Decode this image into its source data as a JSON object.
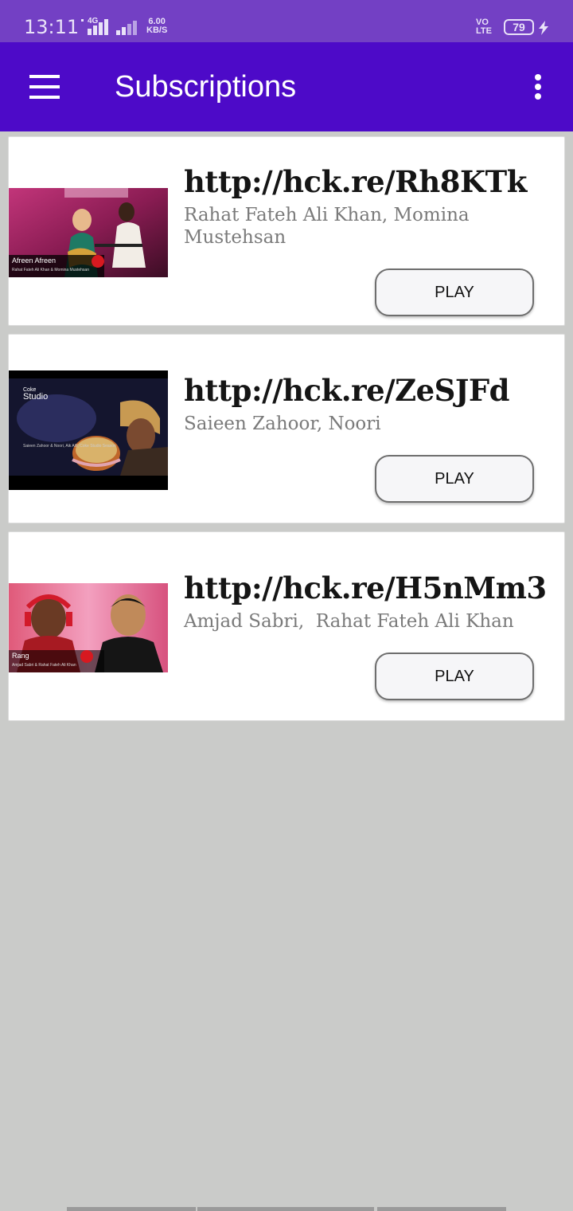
{
  "status_bar": {
    "time": "13:11",
    "network": "4G",
    "speed_value": "6.00",
    "speed_unit": "KB/S",
    "volte_top": "VO",
    "volte_bottom": "LTE",
    "battery": "79",
    "bg_color": "#7340c4"
  },
  "app_bar": {
    "title": "Subscriptions",
    "menu_icon": "hamburger-menu-icon",
    "more_icon": "more-vert-icon",
    "bg_color": "#4d0ac8"
  },
  "subscriptions": [
    {
      "title": "http://hck.re/Rh8KTk",
      "artists": "Rahat Fateh Ali Khan, Momina Mustehsan",
      "thumb_caption": "Afreen Afreen",
      "thumb_subcaption": "Rahat Fateh Ali Khan & Momina Mustehsan",
      "play_label": "PLAY"
    },
    {
      "title": "http://hck.re/ZeSJFd",
      "artists": "Saieen Zahoor, Noori",
      "thumb_caption": "Coke Studio",
      "thumb_subcaption": "Saieen Zahoor & Noori, Aik Alif, Coke Studio Season",
      "play_label": "PLAY"
    },
    {
      "title": "http://hck.re/H5nMm3",
      "artists": "Amjad Sabri,  Rahat Fateh Ali Khan",
      "thumb_caption": "Rang",
      "thumb_subcaption": "Amjad Sabri & Rahat Fateh Ali Khan",
      "play_label": "PLAY"
    }
  ],
  "colors": {
    "background": "#cacbc9",
    "card": "#ffffff",
    "title_text": "#151515",
    "artist_text": "#7a7a7a"
  }
}
